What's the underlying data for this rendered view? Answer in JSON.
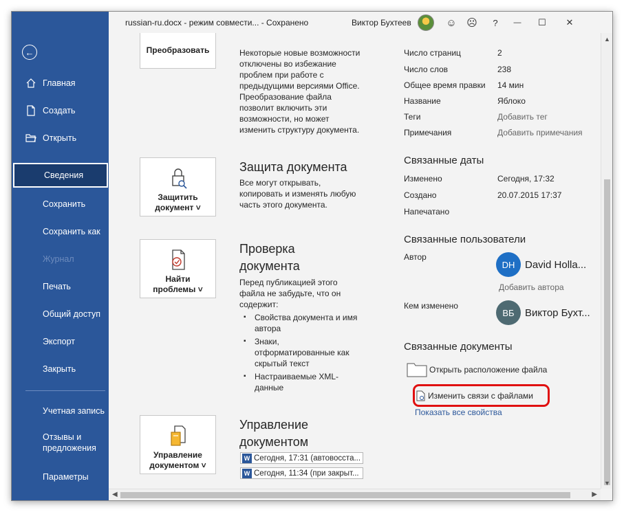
{
  "titlebar": {
    "document": "russian-ru.docx  -  режим совмести...  -  Сохранено",
    "user": "Виктор Бухтеев",
    "smile": "☺",
    "frown": "☹",
    "help": "?",
    "minimize": "—",
    "maximize": "☐",
    "close": "✕"
  },
  "sidebar": {
    "back": "←",
    "items": [
      {
        "label": "Главная"
      },
      {
        "label": "Создать"
      },
      {
        "label": "Открыть"
      },
      {
        "label": "Сведения"
      },
      {
        "label": "Сохранить"
      },
      {
        "label": "Сохранить как"
      },
      {
        "label": "Журнал"
      },
      {
        "label": "Печать"
      },
      {
        "label": "Общий доступ"
      },
      {
        "label": "Экспорт"
      },
      {
        "label": "Закрыть"
      },
      {
        "label": "Учетная запись"
      },
      {
        "label": "Отзывы и"
      },
      {
        "label": "предложения"
      },
      {
        "label": "Параметры"
      }
    ]
  },
  "convert": {
    "button_label": "Преобразовать",
    "lines": [
      "Некоторые новые возможности",
      "отключены во избежание",
      "проблем при работе с",
      "предыдущими версиями Office.",
      "Преобразование файла",
      "позволит включить эти",
      "возможности, но может",
      "изменить структуру документа."
    ]
  },
  "protect": {
    "button_line1": "Защитить",
    "button_line2": "документ ˅",
    "title": "Защита документа",
    "lines": [
      "Все могут открывать,",
      "копировать и изменять любую",
      "часть этого документа."
    ]
  },
  "inspect": {
    "button_line1": "Найти",
    "button_line2": "проблемы ˅",
    "title_line1": "Проверка",
    "title_line2": "документа",
    "lines": [
      "Перед публикацией этого",
      "файла не забудьте, что он",
      "содержит:"
    ],
    "bullets": [
      {
        "line1": "Свойства документа и имя",
        "line2": "автора"
      },
      {
        "line1": "Знаки,",
        "line2": "отформатированные как",
        "line3": "скрытый текст"
      },
      {
        "line1": "Настраиваемые XML-",
        "line2": "данные"
      }
    ]
  },
  "manage": {
    "button_line1": "Управление",
    "button_line2": "документом ˅",
    "title_line1": "Управление",
    "title_line2": "документом",
    "versions": [
      "Сегодня, 17:31 (автовосста...",
      "Сегодня, 11:34 (при закрыт..."
    ]
  },
  "properties": {
    "pages_label": "Число страниц",
    "pages_value": "2",
    "words_label": "Число слов",
    "words_value": "238",
    "edit_label": "Общее время правки",
    "edit_value": "14 мин",
    "title_label": "Название",
    "title_value": "Яблоко",
    "tags_label": "Теги",
    "tags_value": "Добавить тег",
    "notes_label": "Примечания",
    "notes_value": "Добавить примечания"
  },
  "dates": {
    "header": "Связанные даты",
    "modified_label": "Изменено",
    "modified_value": "Сегодня, 17:32",
    "created_label": "Создано",
    "created_value": "20.07.2015 17:37",
    "printed_label": "Напечатано"
  },
  "people": {
    "header": "Связанные пользователи",
    "author_label": "Автор",
    "author_initials": "DH",
    "author_name": "David Holla...",
    "add_author": "Добавить автора",
    "modified_by_label": "Кем изменено",
    "modifier_initials": "ВБ",
    "modifier_name": "Виктор Бухт..."
  },
  "related_docs": {
    "header": "Связанные документы",
    "open_location": "Открыть расположение файла",
    "edit_links": "Изменить связи с файлами",
    "show_all": "Показать все свойства"
  },
  "colors": {
    "sidebar": "#2b579a",
    "author_avatar": "#1e6fc5",
    "modifier_avatar": "#4e6a72",
    "highlight": "#e01010",
    "link": "#2b579a"
  }
}
